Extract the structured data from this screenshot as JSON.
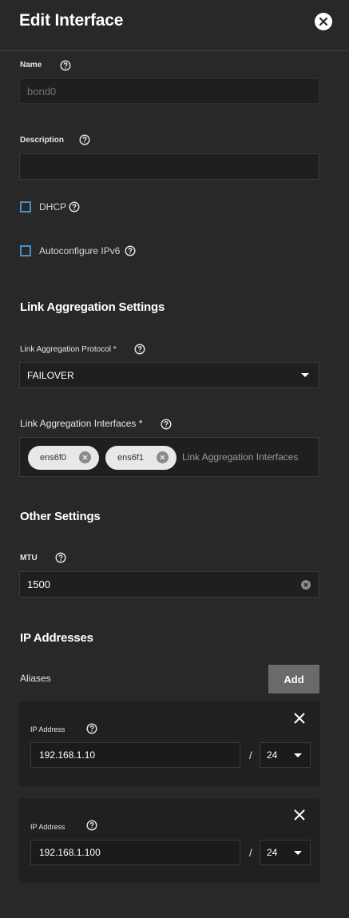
{
  "header": {
    "title": "Edit Interface"
  },
  "name_field": {
    "label": "Name",
    "value": "bond0"
  },
  "description_field": {
    "label": "Description",
    "value": ""
  },
  "dhcp": {
    "label": "DHCP",
    "checked": false
  },
  "autoconfigure_ipv6": {
    "label": "Autoconfigure IPv6",
    "checked": false
  },
  "link_aggregation": {
    "section_title": "Link Aggregation Settings",
    "protocol_label": "Link Aggregation Protocol *",
    "protocol_value": "FAILOVER",
    "interfaces_label": "Link Aggregation Interfaces *",
    "interfaces_placeholder": "Link Aggregation Interfaces",
    "interfaces": [
      "ens6f0",
      "ens6f1"
    ]
  },
  "other_settings": {
    "section_title": "Other Settings",
    "mtu_label": "MTU",
    "mtu_value": "1500"
  },
  "ip_addresses": {
    "section_title": "IP Addresses",
    "aliases_label": "Aliases",
    "add_label": "Add",
    "aliases": [
      {
        "label": "IP Address",
        "address": "192.168.1.10",
        "separator": "/",
        "netmask": "24"
      },
      {
        "label": "IP Address",
        "address": "192.168.1.100",
        "separator": "/",
        "netmask": "24"
      }
    ]
  },
  "colors": {
    "background": "#282828",
    "input_bg": "#1f1f1f",
    "checkbox_border": "#4a90c2",
    "add_button": "#6a6a6a"
  }
}
